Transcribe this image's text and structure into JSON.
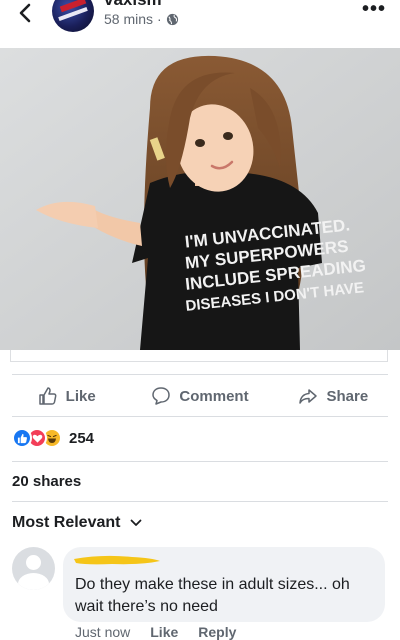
{
  "header": {
    "page_name": "vaxism",
    "timestamp": "58 mins",
    "separator": "·",
    "back_icon": "chevron-left-icon",
    "privacy_icon": "globe-icon",
    "more_label": "•••"
  },
  "photo": {
    "shirt_lines": [
      "I'M UNVACCINATED.",
      "MY SUPERPOWERS",
      "INCLUDE SPREADING",
      "DISEASES I DON'T HAVE"
    ]
  },
  "actions": {
    "like": "Like",
    "comment": "Comment",
    "share": "Share"
  },
  "reactions": {
    "types": [
      "like",
      "love",
      "haha"
    ],
    "count": "254"
  },
  "shares_label": "20 shares",
  "sort_label": "Most Relevant",
  "comment": {
    "text": "Do they make these in adult sizes... oh wait there’s no need",
    "time": "Just now",
    "like": "Like",
    "reply": "Reply"
  },
  "colors": {
    "like_blue": "#1877f2",
    "love_red": "#f33e58",
    "haha_yellow": "#f7b928",
    "redaction": "#f5c518",
    "secondary_text": "#606770"
  }
}
